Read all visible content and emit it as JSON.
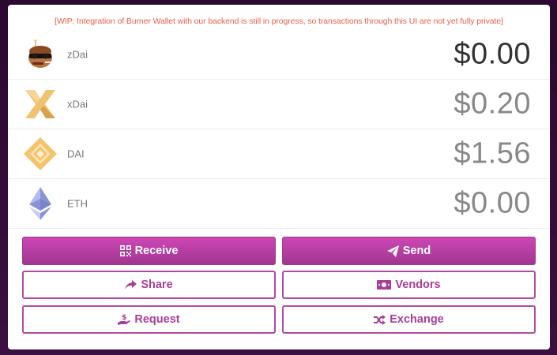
{
  "warning": "[WIP: Integration of Burner Wallet with our backend is still in progress, so transactions through this UI are not yet fully private]",
  "balances": [
    {
      "name": "zDai",
      "amount": "$0.00",
      "icon": "zdai-icon"
    },
    {
      "name": "xDai",
      "amount": "$0.20",
      "icon": "xdai-icon"
    },
    {
      "name": "DAI",
      "amount": "$1.56",
      "icon": "dai-icon"
    },
    {
      "name": "ETH",
      "amount": "$0.00",
      "icon": "eth-icon"
    }
  ],
  "actions": {
    "receive": "Receive",
    "send": "Send",
    "share": "Share",
    "vendors": "Vendors",
    "request": "Request",
    "exchange": "Exchange"
  },
  "colors": {
    "accent": "#b34aa2",
    "warning": "#e8604c",
    "background": "#2a0a2e"
  }
}
